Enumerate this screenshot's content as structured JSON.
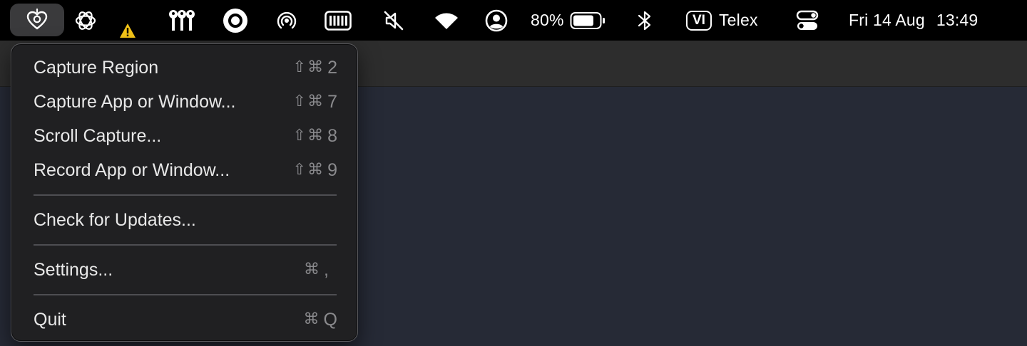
{
  "menubar": {
    "battery_percent": "80%",
    "battery_level": 0.8,
    "input_method_badge": "VI",
    "input_method_name": "Telex",
    "clock": {
      "date": "Fri 14 Aug",
      "time": "13:49"
    },
    "icons": [
      "app-menu-icon",
      "chatgpt-icon",
      "warning-icon",
      "keys-icon",
      "record-disc-icon",
      "airdrop-icon",
      "keyboard-icon",
      "mute-icon",
      "wifi-icon",
      "user-icon",
      "battery-icon",
      "bluetooth-icon",
      "control-center-icon"
    ],
    "colors": {
      "warning": "#f5c518",
      "background": "#000000"
    }
  },
  "menu": {
    "items": [
      {
        "label": "Capture Region",
        "shortcut_mods": "⇧⌘",
        "shortcut_key": "2"
      },
      {
        "label": "Capture App or Window...",
        "shortcut_mods": "⇧⌘",
        "shortcut_key": "7"
      },
      {
        "label": "Scroll Capture...",
        "shortcut_mods": "⇧⌘",
        "shortcut_key": "8"
      },
      {
        "label": "Record App or Window...",
        "shortcut_mods": "⇧⌘",
        "shortcut_key": "9"
      },
      {
        "label": "Check for Updates...",
        "shortcut_mods": "",
        "shortcut_key": ""
      },
      {
        "label": "Settings...",
        "shortcut_mods": "⌘",
        "shortcut_key": ","
      },
      {
        "label": "Quit",
        "shortcut_mods": "⌘",
        "shortcut_key": "Q"
      }
    ]
  }
}
